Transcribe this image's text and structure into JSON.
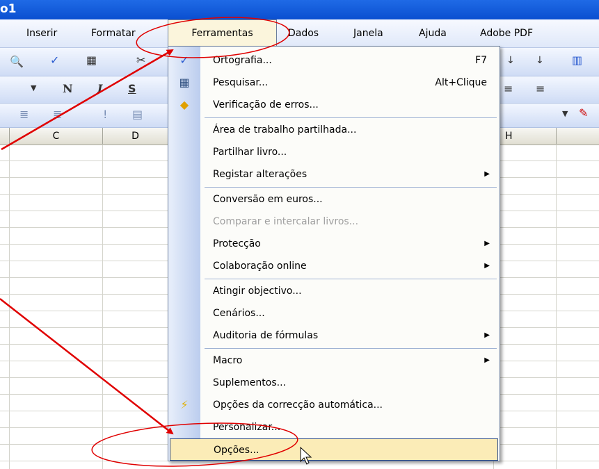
{
  "window": {
    "title_fragment": "o1"
  },
  "menubar": {
    "items": [
      "Inserir",
      "Formatar",
      "Ferramentas",
      "Dados",
      "Janela",
      "Ajuda",
      "Adobe PDF"
    ],
    "active": "Ferramentas"
  },
  "toolbar": {
    "bold_label": "N",
    "italic_label": "I",
    "underline_label": "S"
  },
  "columns": [
    "C",
    "D",
    "H"
  ],
  "dropdown": {
    "items": [
      {
        "label": "Ortografia...",
        "shortcut": "F7",
        "icon": "spellcheck-icon"
      },
      {
        "label": "Pesquisar...",
        "shortcut": "Alt+Clique",
        "icon": "research-icon"
      },
      {
        "label": "Verificação de erros...",
        "icon": "error-check-icon"
      },
      {
        "label": "Área de trabalho partilhada..."
      },
      {
        "label": "Partilhar livro..."
      },
      {
        "label": "Registar alterações",
        "submenu": true
      },
      {
        "label": "Conversão em euros..."
      },
      {
        "label": "Comparar e intercalar livros...",
        "disabled": true
      },
      {
        "label": "Protecção",
        "submenu": true
      },
      {
        "label": "Colaboração online",
        "submenu": true
      },
      {
        "label": "Atingir objectivo..."
      },
      {
        "label": "Cenários..."
      },
      {
        "label": "Auditoria de fórmulas",
        "submenu": true
      },
      {
        "label": "Macro",
        "submenu": true
      },
      {
        "label": "Suplementos..."
      },
      {
        "label": "Opções da correcção automática...",
        "icon": "autocorrect-icon"
      },
      {
        "label": "Personalizar..."
      },
      {
        "label": "Opções...",
        "highlighted": true
      }
    ]
  },
  "annotation_color": "#e00000",
  "highlight_color": "#fbecb7"
}
